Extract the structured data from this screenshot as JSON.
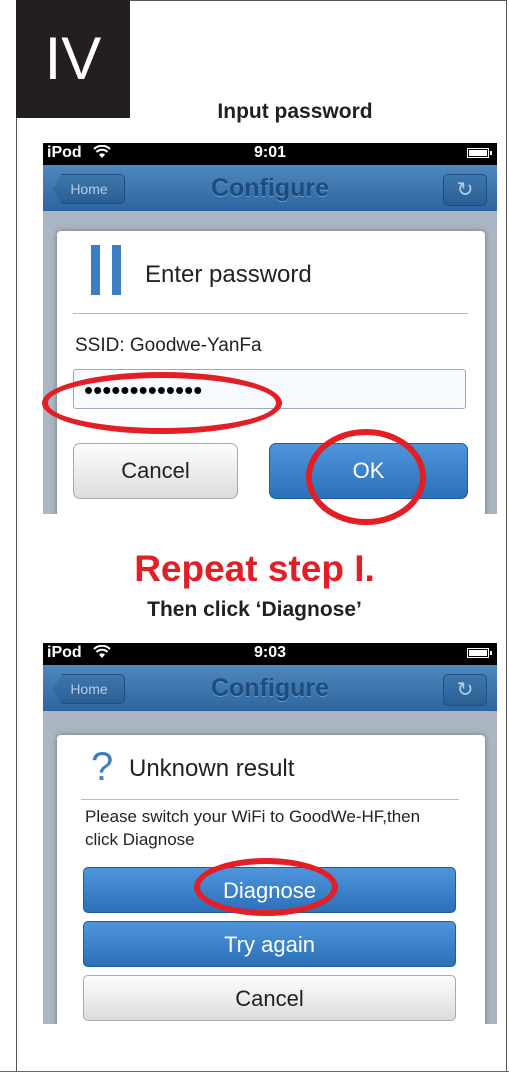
{
  "step": {
    "numeral": "IV",
    "caption": "Input password"
  },
  "screen1": {
    "status": {
      "carrier": "iPod",
      "time": "9:01"
    },
    "nav": {
      "back": "Home",
      "title": "Configure",
      "refresh_icon": "↻"
    },
    "dialog": {
      "title": "Enter password",
      "ssid": "SSID:  Goodwe-YanFa",
      "password": "•••••••••••••",
      "cancel": "Cancel",
      "ok": "OK"
    }
  },
  "repeat": {
    "title": "Repeat step I.",
    "subtitle": "Then click ‘Diagnose’"
  },
  "screen2": {
    "status": {
      "carrier": "iPod",
      "time": "9:03"
    },
    "nav": {
      "back": "Home",
      "title": "Configure",
      "refresh_icon": "↻"
    },
    "dialog": {
      "icon": "?",
      "title": "Unknown result",
      "message": "Please switch your WiFi to GoodWe-HF,then click Diagnose",
      "diagnose": "Diagnose",
      "try_again": "Try again",
      "cancel": "Cancel"
    }
  },
  "colors": {
    "highlight": "#e31e24",
    "button_blue": "#3a82c9",
    "nav_blue": "#3e77ad"
  }
}
